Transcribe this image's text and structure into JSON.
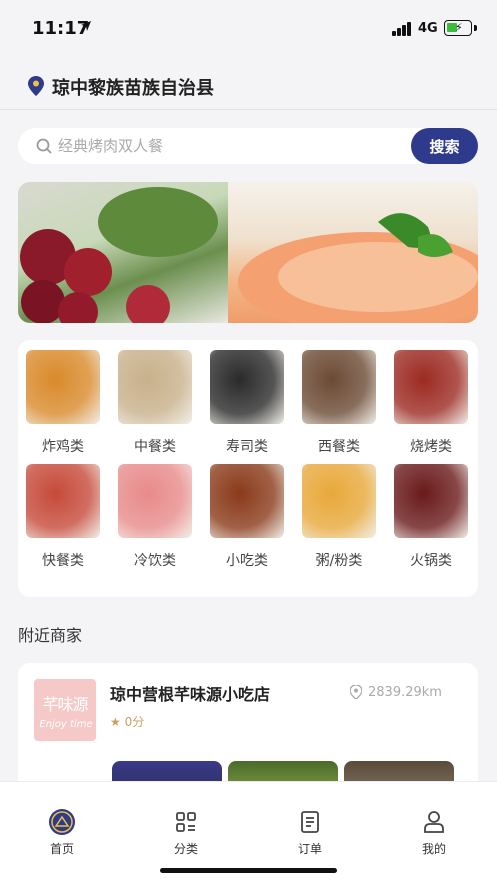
{
  "status": {
    "time": "11:17",
    "network": "4G",
    "battery_color": "#3dbb3d"
  },
  "location": {
    "name": "琼中黎族苗族自治县"
  },
  "search": {
    "placeholder": "经典烤肉双人餐",
    "button": "搜索"
  },
  "categories": [
    {
      "label": "炸鸡类",
      "icon": "fried-chicken-photo",
      "color": "#d98a2b"
    },
    {
      "label": "中餐类",
      "icon": "chinese-food-photo",
      "color": "#c8b08a"
    },
    {
      "label": "寿司类",
      "icon": "sushi-photo",
      "color": "#2a2a2a"
    },
    {
      "label": "西餐类",
      "icon": "steak-photo",
      "color": "#6b4a34"
    },
    {
      "label": "烧烤类",
      "icon": "bbq-photo",
      "color": "#9c2a22"
    },
    {
      "label": "快餐类",
      "icon": "fast-food-photo",
      "color": "#c64a3a"
    },
    {
      "label": "冷饮类",
      "icon": "cold-drink-photo",
      "color": "#e88a8a"
    },
    {
      "label": "小吃类",
      "icon": "snack-photo",
      "color": "#8a3a1a"
    },
    {
      "label": "粥/粉类",
      "icon": "porridge-noodle-photo",
      "color": "#e8a83a"
    },
    {
      "label": "火锅类",
      "icon": "hotpot-photo",
      "color": "#6a1a1a"
    }
  ],
  "nearby": {
    "title": "附近商家",
    "shop": {
      "name": "琼中营根芊味源小吃店",
      "rating": "0分",
      "distance": "2839.29km",
      "logo_text": "芊味源",
      "logo_sub": "Enjoy time"
    }
  },
  "tabs": [
    {
      "label": "首页",
      "icon": "home-icon",
      "active": true
    },
    {
      "label": "分类",
      "icon": "category-icon",
      "active": false
    },
    {
      "label": "订单",
      "icon": "order-icon",
      "active": false
    },
    {
      "label": "我的",
      "icon": "profile-icon",
      "active": false
    }
  ],
  "colors": {
    "accent": "#2e3a8c",
    "background": "#f4f4f6"
  }
}
